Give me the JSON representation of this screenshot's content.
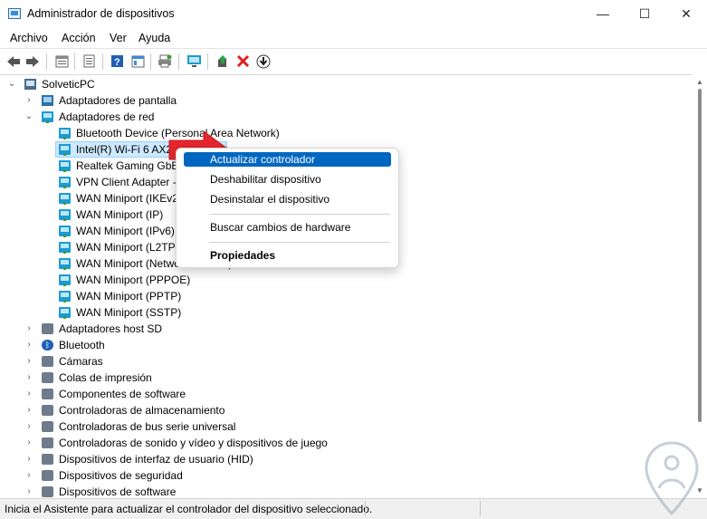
{
  "window": {
    "title": "Administrador de dispositivos",
    "minimize_glyph": "—",
    "maximize_glyph": "☐",
    "close_glyph": "✕"
  },
  "menu": [
    "Archivo",
    "Acción",
    "Ver",
    "Ayuda"
  ],
  "toolbar": {
    "icons": [
      "back-icon",
      "forward-icon",
      "properties-icon",
      "driver-details-icon",
      "help-icon",
      "view-icon",
      "print-icon",
      "monitor-icon",
      "update-driver-icon",
      "uninstall-icon",
      "download-icon"
    ]
  },
  "tree": {
    "root": "SolveticPC",
    "categories": [
      {
        "label": "Adaptadores de pantalla",
        "expanded": false,
        "icon": "monitor-icon"
      },
      {
        "label": "Adaptadores de red",
        "expanded": true,
        "icon": "network-icon",
        "children": [
          "Bluetooth Device (Personal Area Network)",
          "Intel(R) Wi-Fi 6 AX201 160MHz",
          "Realtek Gaming GbE Family Controller",
          "VPN Client Adapter - VPN",
          "WAN Miniport (IKEv2)",
          "WAN Miniport (IP)",
          "WAN Miniport (IPv6)",
          "WAN Miniport (L2TP)",
          "WAN Miniport (Network Monitor)",
          "WAN Miniport (PPPOE)",
          "WAN Miniport (PPTP)",
          "WAN Miniport (SSTP)"
        ]
      },
      {
        "label": "Adaptadores host SD",
        "expanded": false,
        "icon": "sd-host-icon"
      },
      {
        "label": "Bluetooth",
        "expanded": false,
        "icon": "bluetooth-icon"
      },
      {
        "label": "Cámaras",
        "expanded": false,
        "icon": "camera-icon"
      },
      {
        "label": "Colas de impresión",
        "expanded": false,
        "icon": "printer-icon"
      },
      {
        "label": "Componentes de software",
        "expanded": false,
        "icon": "software-icon"
      },
      {
        "label": "Controladoras de almacenamiento",
        "expanded": false,
        "icon": "storage-icon"
      },
      {
        "label": "Controladoras de bus serie universal",
        "expanded": false,
        "icon": "usb-icon"
      },
      {
        "label": "Controladoras de sonido y vídeo y dispositivos de juego",
        "expanded": false,
        "icon": "sound-icon"
      },
      {
        "label": "Dispositivos de interfaz de usuario (HID)",
        "expanded": false,
        "icon": "hid-icon"
      },
      {
        "label": "Dispositivos de seguridad",
        "expanded": false,
        "icon": "security-device-icon"
      },
      {
        "label": "Dispositivos de software",
        "expanded": false,
        "icon": "software-device-icon"
      }
    ]
  },
  "context_menu": {
    "items": [
      {
        "label": "Actualizar controlador",
        "highlighted": true
      },
      {
        "label": "Deshabilitar dispositivo",
        "highlighted": false
      },
      {
        "label": "Desinstalar el dispositivo",
        "highlighted": false
      },
      {
        "label": "Buscar cambios de hardware",
        "highlighted": false
      },
      {
        "label": "Propiedades",
        "highlighted": false,
        "bold": true
      }
    ]
  },
  "status": {
    "text": "Inicia el Asistente para actualizar el controlador del dispositivo seleccionado."
  },
  "colors": {
    "accent": "#0067c0",
    "selection": "#cde8ff",
    "arrow": "#e8262d"
  }
}
